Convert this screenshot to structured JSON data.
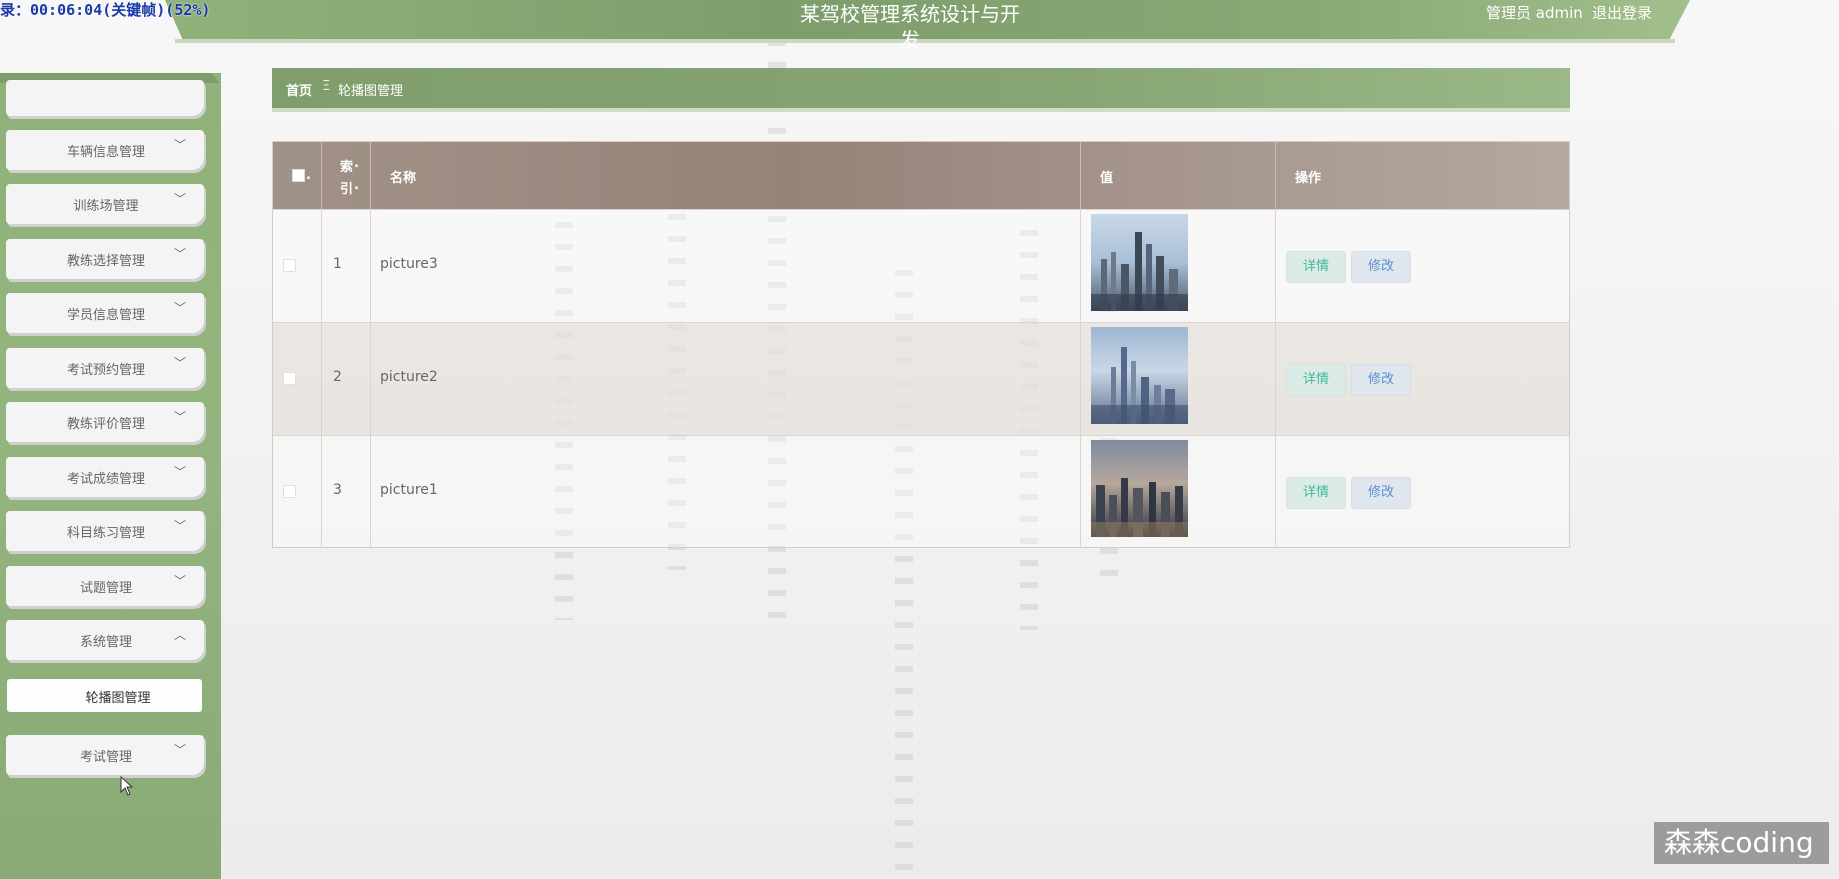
{
  "overlay": {
    "recording_text": "录：00:06:04(关键帧)(52%)"
  },
  "header": {
    "title": "某驾校管理系统设计与开发",
    "user_label": "管理员 admin",
    "logout_label": "退出登录"
  },
  "sidebar": {
    "items": [
      {
        "label": "车辆信息管理",
        "chevron": "chevron-down"
      },
      {
        "label": "训练场管理",
        "chevron": "chevron-down"
      },
      {
        "label": "教练选择管理",
        "chevron": "chevron-down"
      },
      {
        "label": "学员信息管理",
        "chevron": "chevron-down"
      },
      {
        "label": "考试预约管理",
        "chevron": "chevron-down"
      },
      {
        "label": "教练评价管理",
        "chevron": "chevron-down"
      },
      {
        "label": "考试成绩管理",
        "chevron": "chevron-down"
      },
      {
        "label": "科目练习管理",
        "chevron": "chevron-down"
      },
      {
        "label": "试题管理",
        "chevron": "chevron-down"
      },
      {
        "label": "系统管理",
        "chevron": "chevron-up"
      },
      {
        "label": "考试管理",
        "chevron": "chevron-down"
      }
    ],
    "sub_item": {
      "label": "轮播图管理"
    }
  },
  "breadcrumb": {
    "home": "首页",
    "separator": "Ξ",
    "current": "轮播图管理"
  },
  "table": {
    "headers": {
      "index_line1": "索",
      "index_line2": "引",
      "name": "名称",
      "value": "值",
      "actions": "操作"
    },
    "rows": [
      {
        "index": "1",
        "name": "picture3",
        "detail_label": "详情",
        "edit_label": "修改"
      },
      {
        "index": "2",
        "name": "picture2",
        "detail_label": "详情",
        "edit_label": "修改"
      },
      {
        "index": "3",
        "name": "picture1",
        "detail_label": "详情",
        "edit_label": "修改"
      }
    ]
  },
  "watermark": {
    "text": "森森coding"
  },
  "colors": {
    "header_green": "#7e9d6c",
    "table_header": "#968378",
    "detail_button_text": "#3fb89a",
    "edit_button_text": "#5d8fce"
  }
}
